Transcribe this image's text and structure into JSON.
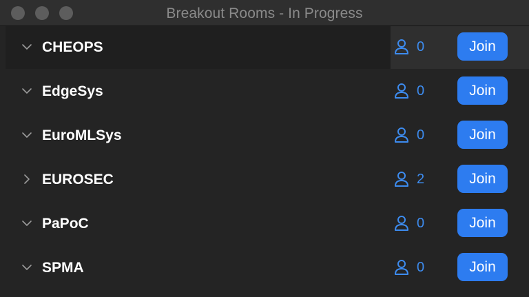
{
  "window": {
    "title": "Breakout Rooms - In Progress"
  },
  "rooms": [
    {
      "name": "CHEOPS",
      "count": "0",
      "expanded": true,
      "join_label": "Join"
    },
    {
      "name": "EdgeSys",
      "count": "0",
      "expanded": true,
      "join_label": "Join"
    },
    {
      "name": "EuroMLSys",
      "count": "0",
      "expanded": true,
      "join_label": "Join"
    },
    {
      "name": "EUROSEC",
      "count": "2",
      "expanded": false,
      "join_label": "Join"
    },
    {
      "name": "PaPoC",
      "count": "0",
      "expanded": true,
      "join_label": "Join"
    },
    {
      "name": "SPMA",
      "count": "0",
      "expanded": true,
      "join_label": "Join"
    }
  ],
  "icons": {
    "expanded": "chevron-down-icon",
    "collapsed": "chevron-right-icon",
    "participants": "person-icon"
  },
  "colors": {
    "accent": "#2d7cf0",
    "count_text": "#3d8cf0",
    "background": "#242424"
  }
}
